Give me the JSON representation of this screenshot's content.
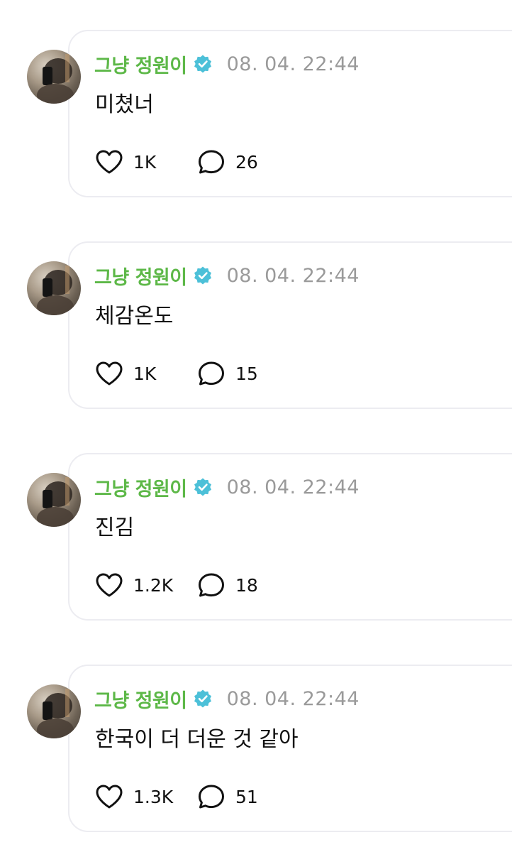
{
  "posts": [
    {
      "author": "그냥 정원이",
      "verified": true,
      "timestamp": "08. 04. 22:44",
      "text": "미쳤너",
      "likes": "1K",
      "replies": "26"
    },
    {
      "author": "그냥 정원이",
      "verified": true,
      "timestamp": "08. 04. 22:44",
      "text": "체감온도",
      "likes": "1K",
      "replies": "15"
    },
    {
      "author": "그냥 정원이",
      "verified": true,
      "timestamp": "08. 04. 22:44",
      "text": "진김",
      "likes": "1.2K",
      "replies": "18"
    },
    {
      "author": "그냥 정원이",
      "verified": true,
      "timestamp": "08. 04. 22:44",
      "text": "한국이 더 더운 것 같아",
      "likes": "1.3K",
      "replies": "51"
    }
  ],
  "icons": {
    "verified": "verified-badge-icon",
    "like": "heart-icon",
    "reply": "speech-bubble-icon"
  },
  "colors": {
    "author_name": "#5db848",
    "verified_badge": "#4cc0d8",
    "timestamp": "#9a9a9a",
    "card_border": "#ececf1"
  }
}
